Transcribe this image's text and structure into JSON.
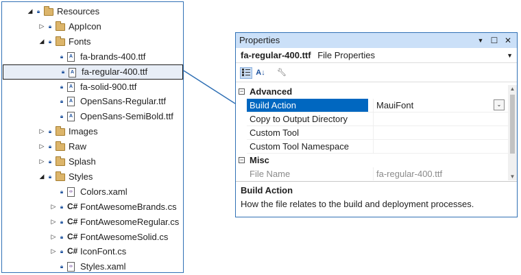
{
  "tree": {
    "items": [
      {
        "label": "Resources",
        "type": "folder",
        "level": 0,
        "arrow": "expanded"
      },
      {
        "label": "AppIcon",
        "type": "folder",
        "level": 1,
        "arrow": "collapsed"
      },
      {
        "label": "Fonts",
        "type": "folder",
        "level": 1,
        "arrow": "expanded"
      },
      {
        "label": "fa-brands-400.ttf",
        "type": "font",
        "level": 2,
        "arrow": "none"
      },
      {
        "label": "fa-regular-400.ttf",
        "type": "font",
        "level": 2,
        "arrow": "none",
        "selected": true
      },
      {
        "label": "fa-solid-900.ttf",
        "type": "font",
        "level": 2,
        "arrow": "none"
      },
      {
        "label": "OpenSans-Regular.ttf",
        "type": "font",
        "level": 2,
        "arrow": "none"
      },
      {
        "label": "OpenSans-SemiBold.ttf",
        "type": "font",
        "level": 2,
        "arrow": "none"
      },
      {
        "label": "Images",
        "type": "folder",
        "level": 1,
        "arrow": "collapsed"
      },
      {
        "label": "Raw",
        "type": "folder",
        "level": 1,
        "arrow": "collapsed"
      },
      {
        "label": "Splash",
        "type": "folder",
        "level": 1,
        "arrow": "collapsed"
      },
      {
        "label": "Styles",
        "type": "folder",
        "level": 1,
        "arrow": "expanded"
      },
      {
        "label": "Colors.xaml",
        "type": "xaml",
        "level": 2,
        "arrow": "none"
      },
      {
        "label": "FontAwesomeBrands.cs",
        "type": "cs",
        "level": 2,
        "arrow": "collapsed"
      },
      {
        "label": "FontAwesomeRegular.cs",
        "type": "cs",
        "level": 2,
        "arrow": "collapsed"
      },
      {
        "label": "FontAwesomeSolid.cs",
        "type": "cs",
        "level": 2,
        "arrow": "collapsed"
      },
      {
        "label": "IconFont.cs",
        "type": "cs",
        "level": 2,
        "arrow": "collapsed"
      },
      {
        "label": "Styles.xaml",
        "type": "xaml",
        "level": 2,
        "arrow": "none"
      }
    ]
  },
  "properties": {
    "title": "Properties",
    "object_name": "fa-regular-400.ttf",
    "object_type": "File Properties",
    "categories": [
      {
        "name": "Advanced",
        "props": [
          {
            "name": "Build Action",
            "value": "MauiFont",
            "selected": true,
            "combo": true
          },
          {
            "name": "Copy to Output Directory",
            "value": ""
          },
          {
            "name": "Custom Tool",
            "value": ""
          },
          {
            "name": "Custom Tool Namespace",
            "value": ""
          }
        ]
      },
      {
        "name": "Misc",
        "props": [
          {
            "name": "File Name",
            "value": "fa-regular-400.ttf",
            "gray": true
          }
        ]
      }
    ],
    "description": {
      "title": "Build Action",
      "text": "How the file relates to the build and deployment processes."
    }
  },
  "icons": {
    "expanded_arrow": "expanded-arrow-icon",
    "collapsed_arrow": "collapsed-arrow-icon",
    "lock": "lock-icon",
    "folder": "folder-icon",
    "font_file": "font-file-icon",
    "cs_file": "csharp-file-icon",
    "xaml_file": "xaml-file-icon",
    "categorized": "categorized-icon",
    "alphabetical": "alphabetical-icon",
    "property_pages": "wrench-icon"
  },
  "colors": {
    "window_border": "#2e6fb4",
    "title_bar": "#cbe0f8",
    "selection": "#0067c0",
    "folder": "#dcb56b"
  }
}
